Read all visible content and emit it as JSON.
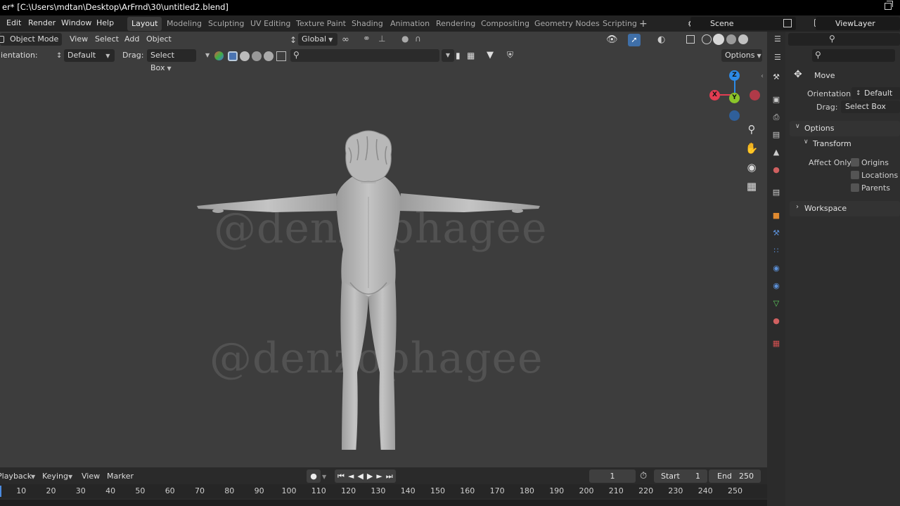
{
  "window": {
    "title": "er* [C:\\Users\\mdtan\\Desktop\\ArFrnd\\30\\untitled2.blend]"
  },
  "menu": {
    "items": [
      "Edit",
      "Render",
      "Window",
      "Help"
    ]
  },
  "workspaces": {
    "tabs": [
      "Layout",
      "Modeling",
      "Sculpting",
      "UV Editing",
      "Texture Paint",
      "Shading",
      "Animation",
      "Rendering",
      "Compositing",
      "Geometry Nodes",
      "Scripting"
    ],
    "active": "Layout",
    "add": "+"
  },
  "scene": {
    "label": "Scene",
    "view_layer": "ViewLayer"
  },
  "viewport": {
    "mode": "Object Mode",
    "menus": [
      "View",
      "Select",
      "Add",
      "Object"
    ],
    "transform_orientation": "Global",
    "tool_row": {
      "orientation_label": "ientation:",
      "orientation_value": "Default",
      "drag_label": "Drag:",
      "drag_value": "Select Box",
      "options": "Options"
    },
    "watermark": "@denzophagee",
    "gizmo": {
      "z": "Z",
      "y": "Y",
      "x": "X"
    },
    "colors": {
      "x": "#e23d52",
      "y": "#8bc52a",
      "z": "#2d8ae6",
      "background": "#3d3d3d"
    }
  },
  "properties": {
    "tool_name": "Move",
    "orientation_label": "Orientation",
    "orientation_value": "Default",
    "drag_label": "Drag:",
    "drag_value": "Select Box",
    "options_section": "Options",
    "transform_section": "Transform",
    "affect_only_label": "Affect Only",
    "checkboxes": [
      "Origins",
      "Locations",
      "Parents"
    ],
    "workspace_section": "Workspace"
  },
  "timeline": {
    "menus": [
      "Playback",
      "Keying",
      "View",
      "Marker"
    ],
    "current_frame": "1",
    "start_label": "Start",
    "start_value": "1",
    "end_label": "End",
    "end_value": "250",
    "ticks": [
      "10",
      "20",
      "30",
      "40",
      "50",
      "60",
      "70",
      "80",
      "90",
      "100",
      "110",
      "120",
      "130",
      "140",
      "150",
      "160",
      "170",
      "180",
      "190",
      "200",
      "210",
      "220",
      "230",
      "240",
      "250"
    ]
  }
}
